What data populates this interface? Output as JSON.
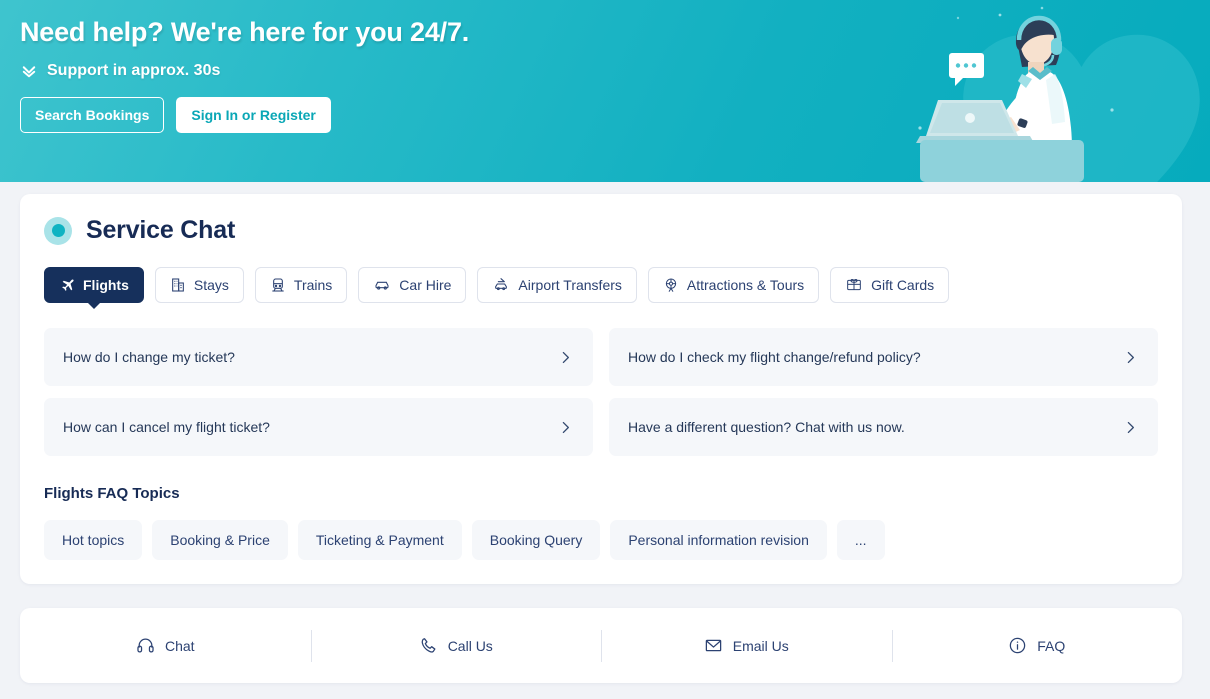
{
  "hero": {
    "title": "Need help? We're here for you 24/7.",
    "subtitle": "Support in approx. 30s",
    "chevron_icon": "double-chevron-down-icon",
    "search_bookings_label": "Search Bookings",
    "sign_in_label": "Sign In or Register",
    "illustration": "customer-service-agent-illustration",
    "bg_color_start": "#3fc4ce",
    "bg_color_end": "#06abbd"
  },
  "service_chat": {
    "title": "Service Chat",
    "status_dot_color": "#0fb3c2",
    "tabs": [
      {
        "label": "Flights",
        "icon": "airplane-icon",
        "active": true
      },
      {
        "label": "Stays",
        "icon": "hotel-icon",
        "active": false
      },
      {
        "label": "Trains",
        "icon": "train-icon",
        "active": false
      },
      {
        "label": "Car Hire",
        "icon": "car-icon",
        "active": false
      },
      {
        "label": "Airport Transfers",
        "icon": "airport-transfer-icon",
        "active": false
      },
      {
        "label": "Attractions & Tours",
        "icon": "ferris-wheel-icon",
        "active": false
      },
      {
        "label": "Gift Cards",
        "icon": "gift-card-icon",
        "active": false
      }
    ],
    "questions": [
      {
        "text": "How do I change my ticket?"
      },
      {
        "text": "How do I check my flight change/refund policy?"
      },
      {
        "text": "How can I cancel my flight ticket?"
      },
      {
        "text": "Have a different question? Chat with us now."
      }
    ],
    "topics_heading": "Flights FAQ Topics",
    "topics": [
      {
        "label": "Hot topics"
      },
      {
        "label": "Booking & Price"
      },
      {
        "label": "Ticketing & Payment"
      },
      {
        "label": "Booking Query"
      },
      {
        "label": "Personal information revision"
      },
      {
        "label": "..."
      }
    ],
    "active_tab_color": "#16305c"
  },
  "footer": {
    "items": [
      {
        "label": "Chat",
        "icon": "headset-icon"
      },
      {
        "label": "Call Us",
        "icon": "phone-icon"
      },
      {
        "label": "Email Us",
        "icon": "envelope-icon"
      },
      {
        "label": "FAQ",
        "icon": "info-circle-icon"
      }
    ]
  }
}
